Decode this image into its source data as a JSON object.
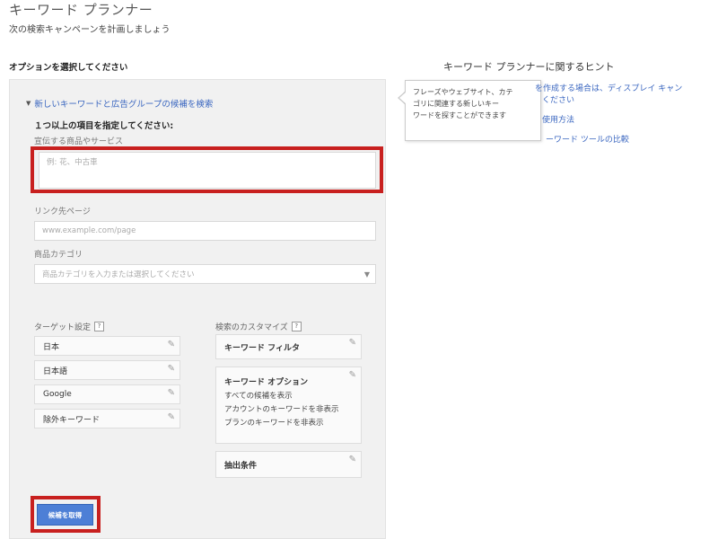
{
  "header": {
    "title": "キーワード プランナー",
    "subtitle": "次の検索キャンペーンを計画しましょう"
  },
  "options": {
    "section_title": "オプションを選択してください",
    "expander_label": "新しいキーワードと広告グループの候補を検索",
    "required_label": "１つ以上の項目を指定してください:",
    "product_label": "宣伝する商品やサービス",
    "product_placeholder": "例: 花、中古車",
    "landing_label": "リンク先ページ",
    "landing_placeholder": "www.example.com/page",
    "category_label": "商品カテゴリ",
    "category_placeholder": "商品カテゴリを入力または選択してください",
    "targeting_label": "ターゲット設定",
    "targeting_items": [
      "日本",
      "日本語",
      "Google",
      "除外キーワード"
    ],
    "customize_label": "検索のカスタマイズ",
    "keyword_filter_label": "キーワード フィルタ",
    "keyword_options_label": "キーワード オプション",
    "keyword_options_lines": [
      "すべての候補を表示",
      "アカウントのキーワードを非表示",
      "プランのキーワードを非表示"
    ],
    "extract_label": "抽出条件",
    "submit_label": "候補を取得",
    "help_glyph": "?"
  },
  "tooltip": {
    "lines": [
      "フレーズやウェブサイト、カテ",
      "ゴリに関連する新しいキー",
      "ワードを探すことができます"
    ]
  },
  "hints": {
    "title": "キーワード プランナーに関するヒント",
    "link_1_line_1": "を作成する場合は、ディスプレイ キャン",
    "link_1_line_2": "ください",
    "link_2": "使用方法",
    "link_3": "ーワード ツールの比較"
  },
  "colors": {
    "accent": "#3b67c0",
    "button": "#4d7fd6",
    "highlight": "#c8201f",
    "panel_bg": "#f1f1f1"
  },
  "icons": {
    "expander": "triangle-down-icon",
    "edit": "pencil-icon",
    "dropdown": "chevron-down-icon",
    "help": "help-icon"
  }
}
